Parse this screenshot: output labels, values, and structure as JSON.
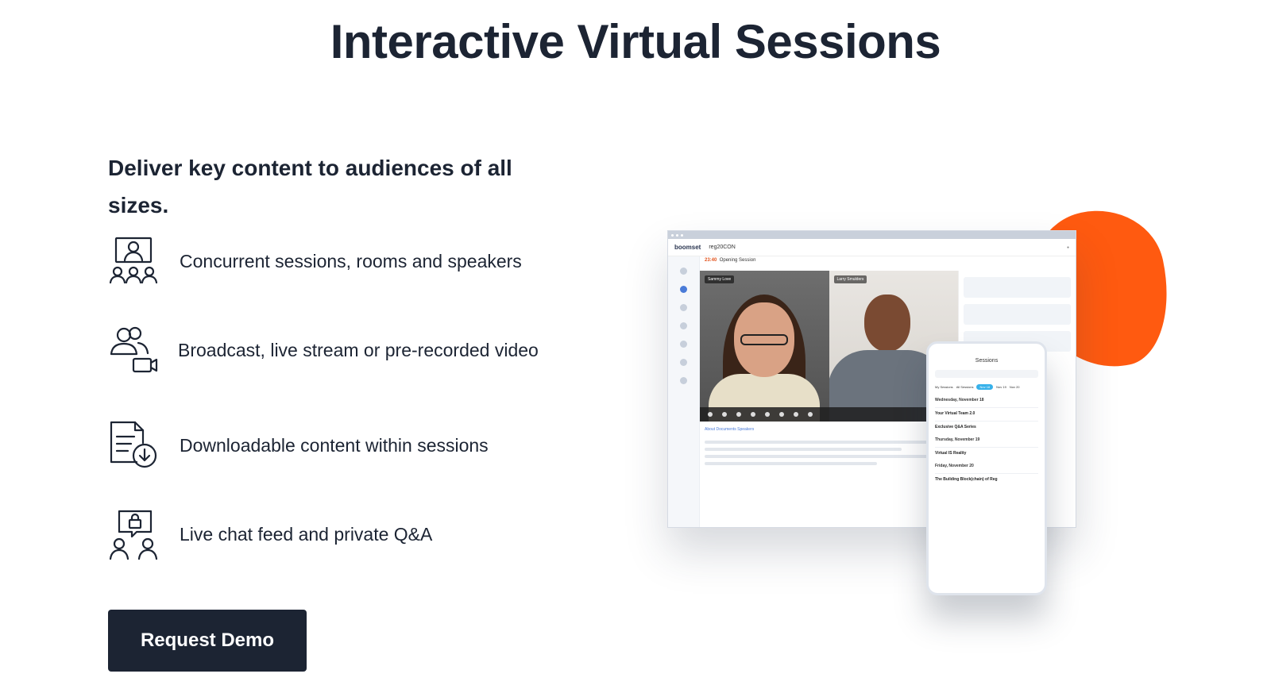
{
  "page": {
    "title": "Interactive Virtual Sessions",
    "subtitle": "Deliver key content to audiences of all sizes."
  },
  "features": [
    {
      "icon": "presenter-audience-icon",
      "text": "Concurrent sessions, rooms and speakers"
    },
    {
      "icon": "users-video-camera-icon",
      "text": "Broadcast, live stream or pre-recorded video"
    },
    {
      "icon": "document-download-icon",
      "text": "Downloadable content within sessions"
    },
    {
      "icon": "chat-lock-users-icon",
      "text": "Live chat feed and private Q&A"
    }
  ],
  "cta": {
    "label": "Request Demo"
  },
  "illustration": {
    "app_logo": "boomset",
    "event_name": "reg20CON",
    "session_time": "23:40",
    "session_label": "Opening Session",
    "speaker_left": "Sammy Love",
    "speaker_right": "Larry Smulders",
    "about_tabs": "About   Documents   Speakers",
    "phone_title": "Sessions",
    "phone_filters": [
      "My Sessions",
      "All Sessions",
      "Nov 18",
      "Nov 19",
      "Nov 20"
    ],
    "phone_day_1": "Wednesday, November 18",
    "phone_session_1": "Your Virtual Team 2.0",
    "phone_session_2": "Exclusive Q&A Series",
    "phone_day_2": "Thursday, November 19",
    "phone_session_3": "Virtual IS Reality",
    "phone_day_3": "Friday, November 20",
    "phone_session_4": "The Building Block(chain) of Reg"
  },
  "colors": {
    "text": "#1c2433",
    "button_bg": "#1c2433",
    "accent_orange": "#ff5a10",
    "accent_blue": "#37b1ea"
  }
}
